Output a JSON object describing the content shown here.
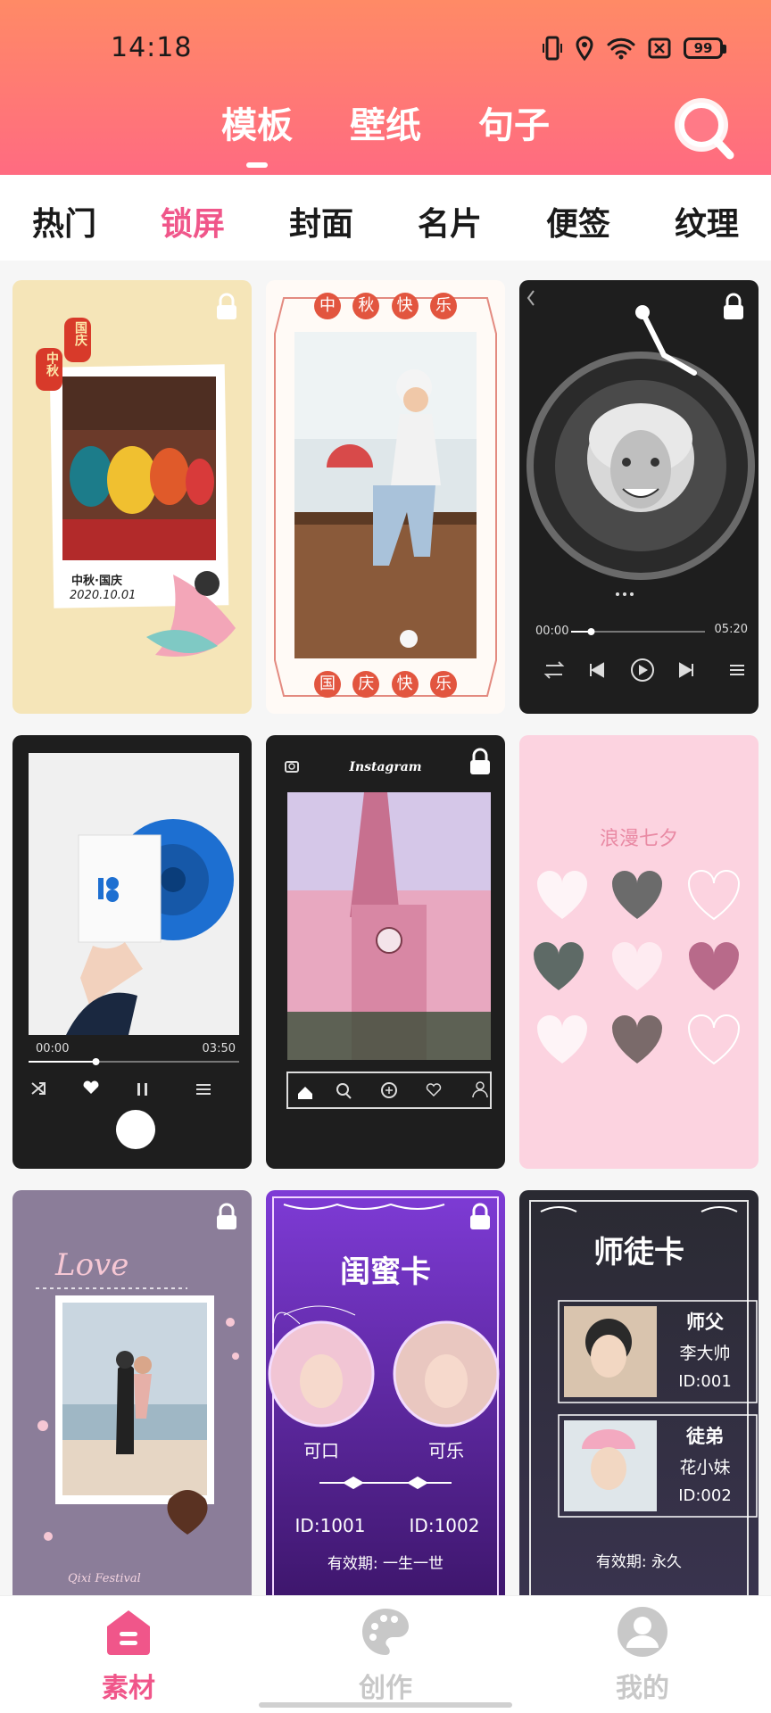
{
  "status_bar": {
    "time": "14:18",
    "battery": "99"
  },
  "top_tabs": [
    {
      "label": "模板"
    },
    {
      "label": "壁纸"
    },
    {
      "label": "句子"
    }
  ],
  "categories": [
    {
      "label": "热门"
    },
    {
      "label": "锁屏"
    },
    {
      "label": "封面"
    },
    {
      "label": "名片"
    },
    {
      "label": "便签"
    },
    {
      "label": "纹理"
    }
  ],
  "active_category": "锁屏",
  "cards": {
    "mid_autumn": {
      "lantern_left": "中秋",
      "lantern_right": "国庆",
      "caption": "中秋·国庆",
      "date": "2020.10.01"
    },
    "festival_frame": {
      "top_chars": [
        "中",
        "秋",
        "快",
        "乐"
      ],
      "bottom_chars": [
        "国",
        "庆",
        "快",
        "乐"
      ]
    },
    "vinyl_player": {
      "time_start": "00:00",
      "time_end": "05:20",
      "progress": 0.15
    },
    "music_player": {
      "time_start": "00:00",
      "time_end": "03:50",
      "progress": 0.32
    },
    "instagram": {
      "title": "Instagram"
    },
    "qixi_hearts": {
      "title": "浪漫七夕"
    },
    "love_photo": {
      "title": "Love",
      "footer": "Qixi Festival"
    },
    "bestie_card": {
      "title": "闺蜜卡",
      "name_left": "可口",
      "name_right": "可乐",
      "id_left": "ID:1001",
      "id_right": "ID:1002",
      "validity": "有效期: 一生一世"
    },
    "mentor_card": {
      "title": "师徒卡",
      "role_1": "师父",
      "name_1": "李大帅",
      "id_1": "ID:001",
      "role_2": "徒弟",
      "name_2": "花小妹",
      "id_2": "ID:002",
      "validity": "有效期: 永久"
    }
  },
  "bottom_nav": [
    {
      "label": "素材"
    },
    {
      "label": "创作"
    },
    {
      "label": "我的"
    }
  ],
  "colors": {
    "accent": "#f0568a",
    "header_top": "#ff8a66",
    "header_bottom": "#ff6b81"
  }
}
